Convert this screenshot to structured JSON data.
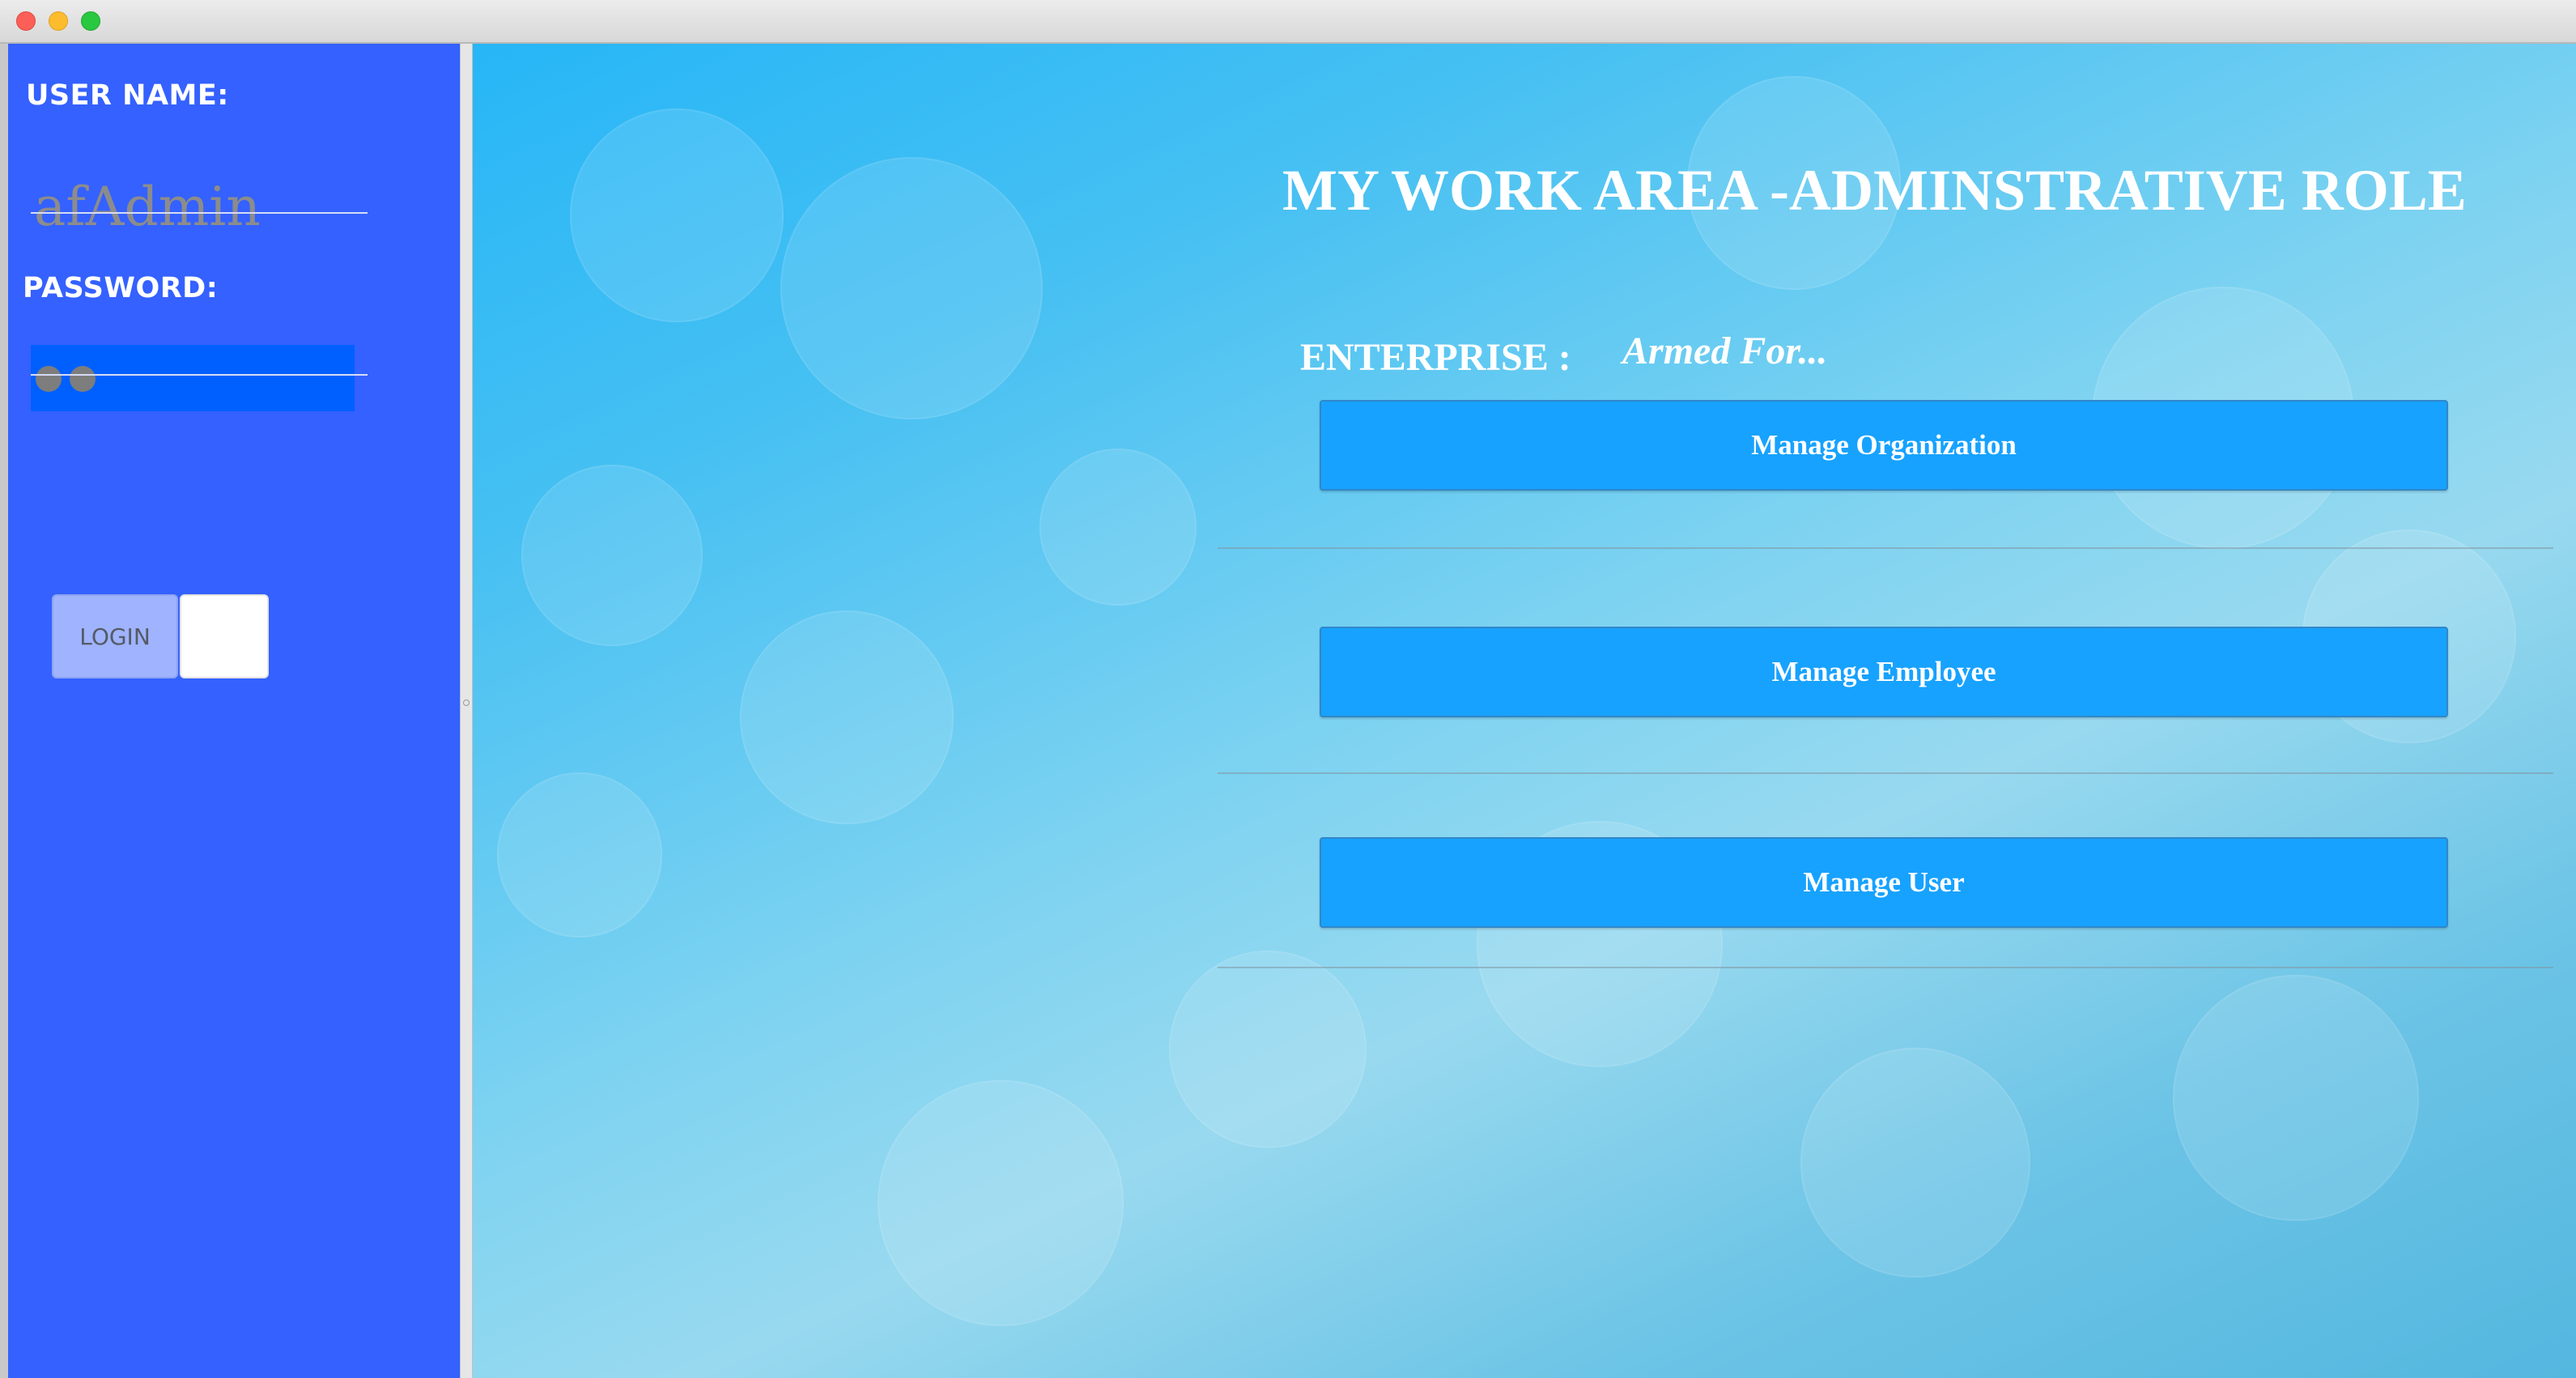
{
  "window": {
    "controls": [
      "close-button",
      "minimize-button",
      "maximize-button"
    ]
  },
  "login_panel": {
    "username_label": "USER NAME:",
    "username_value": "afAdmin",
    "password_label": "PASSWORD:",
    "password_mask_count": 2,
    "login_button_label": "LOGIN",
    "blank_button_label": ""
  },
  "work_area": {
    "title": "MY WORK AREA -ADMINSTRATIVE ROLE",
    "enterprise_label": "ENTERPRISE :",
    "enterprise_value": "Armed For...",
    "buttons": [
      {
        "label": "Manage Organization"
      },
      {
        "label": "Manage Employee"
      },
      {
        "label": "Manage User"
      }
    ]
  },
  "colors": {
    "left_panel": "#3461ff",
    "password_field": "#0060ff",
    "login_button": "#9fb3ff",
    "action_button": "#17a2ff",
    "close": "#fc5f57",
    "minimize": "#fdbc2e",
    "maximize": "#28c840"
  }
}
